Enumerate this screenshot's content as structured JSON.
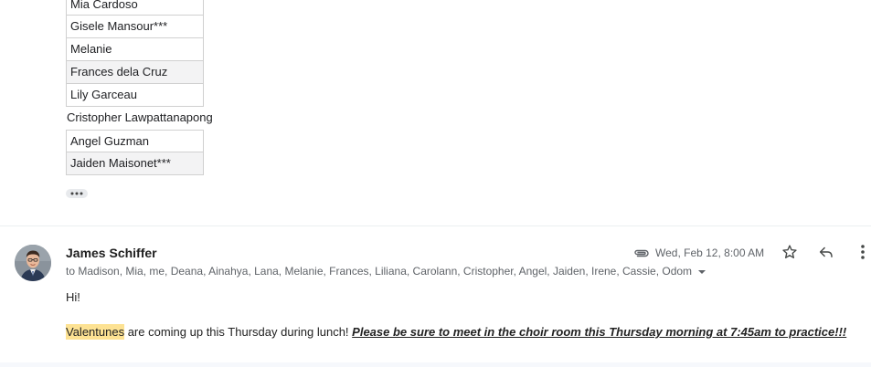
{
  "name_list": [
    {
      "name": "Mia Cardoso",
      "style": "boxed"
    },
    {
      "name": "Gisele Mansour***",
      "style": "boxed"
    },
    {
      "name": "Melanie",
      "style": "boxed"
    },
    {
      "name": "Frances dela Cruz",
      "style": "boxed-shaded"
    },
    {
      "name": "Lily Garceau",
      "style": "boxed"
    },
    {
      "name": "Cristopher Lawpattanapong",
      "style": "plain"
    },
    {
      "name": "Angel Guzman",
      "style": "boxed"
    },
    {
      "name": "Jaiden Maisonet***",
      "style": "boxed-shaded"
    }
  ],
  "email": {
    "sender": "James Schiffer",
    "recipients": "to Madison, Mia, me, Deana, Ainahya, Lana, Melanie, Frances, Liliana, Carolann, Cristopher, Angel, Jaiden, Irene, Cassie, Odom",
    "date": "Wed, Feb 12, 8:00 AM",
    "greeting": "Hi!",
    "highlighted_word": "Valentunes",
    "body_text": " are coming up this Thursday during lunch! ",
    "emphasis_text": "Please be sure to meet in the choir room this Thursday morning at 7:45am to practice!!!"
  },
  "icons": {
    "show_trimmed": "more-horizontal-icon",
    "attachment": "paperclip-icon",
    "star": "star-outline-icon",
    "reply": "reply-icon",
    "more": "more-vertical-icon",
    "recipients_caret": "caret-down-icon"
  },
  "colors": {
    "highlight": "#fde293",
    "sender": "#1f1f1f",
    "meta": "#5f6368"
  }
}
